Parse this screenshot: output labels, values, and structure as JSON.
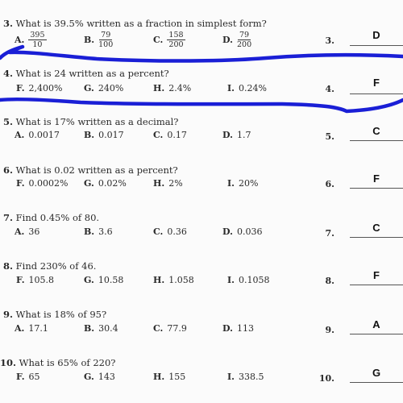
{
  "questions": [
    {
      "number": "3.",
      "text": "What is 39.5% written as a fraction in simplest form?",
      "choices": [
        {
          "letter": "A.",
          "numerator": "395",
          "denominator": "10"
        },
        {
          "letter": "B.",
          "numerator": "79",
          "denominator": "100"
        },
        {
          "letter": "C.",
          "numerator": "158",
          "denominator": "200"
        },
        {
          "letter": "D.",
          "numerator": "79",
          "denominator": "200"
        }
      ],
      "answer_label": "3.",
      "answer": "D"
    },
    {
      "number": "4.",
      "text": "What is 24 written as a percent?",
      "choices": [
        {
          "letter": "F.",
          "value": "2,400%"
        },
        {
          "letter": "G.",
          "value": "240%"
        },
        {
          "letter": "H.",
          "value": "2.4%"
        },
        {
          "letter": "I.",
          "value": "0.24%"
        }
      ],
      "answer_label": "4.",
      "answer": "F"
    },
    {
      "number": "5.",
      "text": "What is 17% written as a decimal?",
      "choices": [
        {
          "letter": "A.",
          "value": "0.0017"
        },
        {
          "letter": "B.",
          "value": "0.017"
        },
        {
          "letter": "C.",
          "value": "0.17"
        },
        {
          "letter": "D.",
          "value": "1.7"
        }
      ],
      "answer_label": "5.",
      "answer": "C"
    },
    {
      "number": "6.",
      "text": "What is 0.02 written as a percent?",
      "choices": [
        {
          "letter": "F.",
          "value": "0.0002%"
        },
        {
          "letter": "G.",
          "value": "0.02%"
        },
        {
          "letter": "H.",
          "value": "2%"
        },
        {
          "letter": "I.",
          "value": "20%"
        }
      ],
      "answer_label": "6.",
      "answer": "F"
    },
    {
      "number": "7.",
      "text": "Find 0.45% of 80.",
      "choices": [
        {
          "letter": "A.",
          "value": "36"
        },
        {
          "letter": "B.",
          "value": "3.6"
        },
        {
          "letter": "C.",
          "value": "0.36"
        },
        {
          "letter": "D.",
          "value": "0.036"
        }
      ],
      "answer_label": "7.",
      "answer": "C"
    },
    {
      "number": "8.",
      "text": "Find 230% of 46.",
      "choices": [
        {
          "letter": "F.",
          "value": "105.8"
        },
        {
          "letter": "G.",
          "value": "10.58"
        },
        {
          "letter": "H.",
          "value": "1.058"
        },
        {
          "letter": "I.",
          "value": "0.1058"
        }
      ],
      "answer_label": "8.",
      "answer": "F"
    },
    {
      "number": "9.",
      "text": "What is 18% of 95?",
      "choices": [
        {
          "letter": "A.",
          "value": "17.1"
        },
        {
          "letter": "B.",
          "value": "30.4"
        },
        {
          "letter": "C.",
          "value": "77.9"
        },
        {
          "letter": "D.",
          "value": "113"
        }
      ],
      "answer_label": "9.",
      "answer": "A"
    },
    {
      "number": "10.",
      "text": "What is 65% of 220?",
      "choices": [
        {
          "letter": "F.",
          "value": "65"
        },
        {
          "letter": "G.",
          "value": "143"
        },
        {
          "letter": "H.",
          "value": "155"
        },
        {
          "letter": "I.",
          "value": "338.5"
        }
      ],
      "answer_label": "10.",
      "answer": "G"
    }
  ],
  "annotation": {
    "description": "hand-drawn blue outline around question 4",
    "color": "#1a1fd6"
  }
}
